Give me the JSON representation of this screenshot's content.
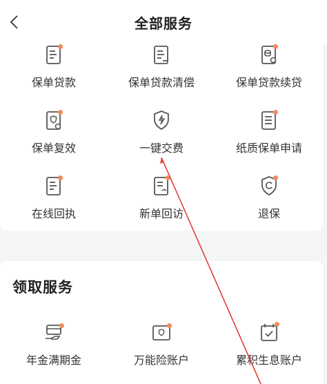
{
  "header": {
    "title": "全部服务"
  },
  "services": [
    {
      "label": "保单贷款",
      "icon": "document-icon"
    },
    {
      "label": "保单贷款清偿",
      "icon": "document-icon"
    },
    {
      "label": "保单贷款续贷",
      "icon": "document-refresh-icon"
    },
    {
      "label": "保单复效",
      "icon": "policy-refresh-icon"
    },
    {
      "label": "一键交费",
      "icon": "shield-lightning-icon"
    },
    {
      "label": "纸质保单申请",
      "icon": "document-icon"
    },
    {
      "label": "在线回执",
      "icon": "document-icon"
    },
    {
      "label": "新单回访",
      "icon": "document-phone-icon"
    },
    {
      "label": "退保",
      "icon": "shield-refresh-icon"
    }
  ],
  "claim_section": {
    "title": "领取服务",
    "items": [
      {
        "label": "年金满期金",
        "icon": "card-hand-icon"
      },
      {
        "label": "万能险账户",
        "icon": "wallet-icon"
      },
      {
        "label": "累积生息账户",
        "icon": "calendar-check-icon"
      }
    ]
  },
  "colors": {
    "accent_dot": "#f28b5b",
    "annotation_line": "#e0403a",
    "icon_stroke": "#555555"
  }
}
